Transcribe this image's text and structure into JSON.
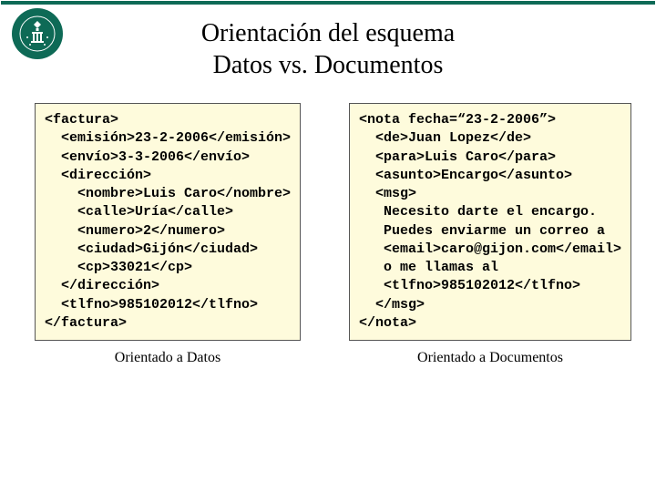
{
  "title_line1": "Orientación del esquema",
  "title_line2": "Datos vs. Documentos",
  "left": {
    "caption": "Orientado a Datos",
    "code": "<factura>\n  <emisión>23-2-2006</emisión>\n  <envío>3-3-2006</envío>\n  <dirección>\n    <nombre>Luis Caro</nombre>\n    <calle>Uría</calle>\n    <numero>2</numero>\n    <ciudad>Gijón</ciudad>\n    <cp>33021</cp>\n  </dirección>\n  <tlfno>985102012</tlfno>\n</factura>"
  },
  "right": {
    "caption": "Orientado a Documentos",
    "code": "<nota fecha=“23-2-2006”>\n  <de>Juan Lopez</de>\n  <para>Luis Caro</para>\n  <asunto>Encargo</asunto>\n  <msg>\n   Necesito darte el encargo.\n   Puedes enviarme un correo a\n   <email>caro@gijon.com</email>\n   o me llamas al\n   <tlfno>985102012</tlfno>\n  </msg>\n</nota>"
  }
}
